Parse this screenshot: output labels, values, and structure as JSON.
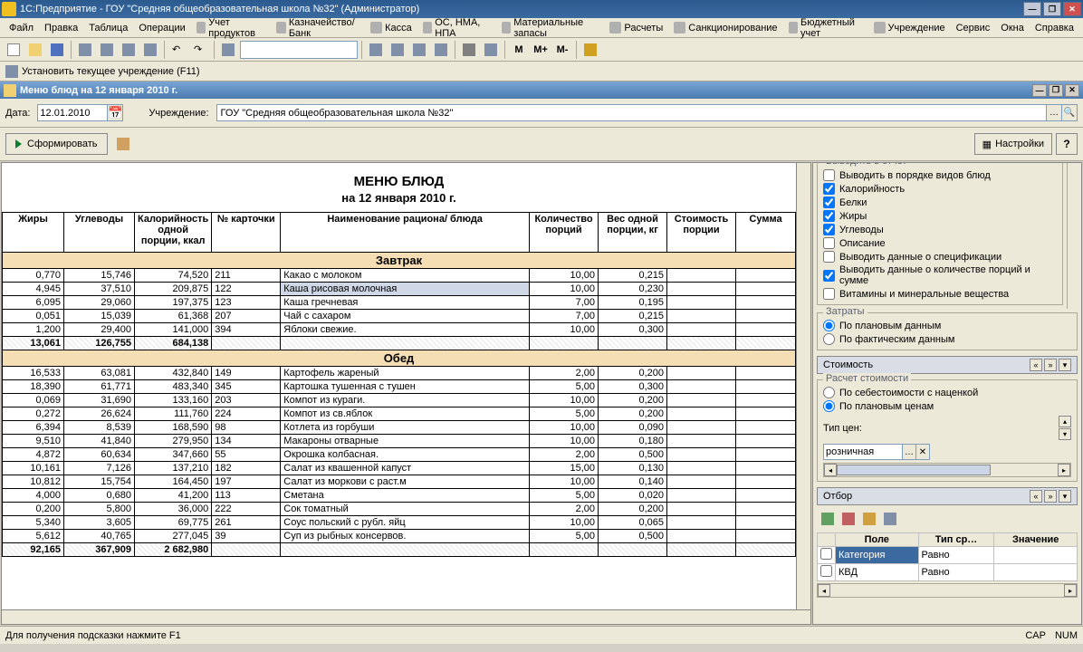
{
  "app_title": "1С:Предприятие - ГОУ \"Средняя общеобразовательная школа №32\" (Администратор)",
  "menu": [
    "Файл",
    "Правка",
    "Таблица",
    "Операции",
    "Учет продуктов",
    "Казначейство/Банк",
    "Касса",
    "ОС, НМА, НПА",
    "Материальные запасы",
    "Расчеты",
    "Санкционирование",
    "Бюджетный учет",
    "Учреждение",
    "Сервис",
    "Окна",
    "Справка"
  ],
  "subbar_text": "Установить текущее учреждение (F11)",
  "tb_mtext": [
    "M",
    "M+",
    "M-"
  ],
  "doc_title": "Меню блюд на 12 января 2010 г.",
  "params": {
    "date_label": "Дата:",
    "date_value": "12.01.2010",
    "org_label": "Учреждение:",
    "org_value": "ГОУ \"Средняя общеобразовательная школа №32\""
  },
  "form_btn": "Сформировать",
  "settings_btn": "Настройки",
  "report": {
    "title": "МЕНЮ БЛЮД",
    "subtitle": "на 12 января 2010 г.",
    "headers": [
      "Жиры",
      "Углеводы",
      "Калорийность одной порции, ккал",
      "№ карточки",
      "Наименование рациона/ блюда",
      "Количество порций",
      "Вес одной порции, кг",
      "Стоимость порции",
      "Сумма"
    ],
    "sections": [
      {
        "name": "Завтрак",
        "rows": [
          {
            "f": "0,770",
            "c": "15,746",
            "k": "74,520",
            "n": "211",
            "d": "Какао с молоком",
            "q": "10,00",
            "w": "0,215"
          },
          {
            "f": "4,945",
            "c": "37,510",
            "k": "209,875",
            "n": "122",
            "d": "Каша рисовая молочная",
            "q": "10,00",
            "w": "0,230",
            "sel": true
          },
          {
            "f": "6,095",
            "c": "29,060",
            "k": "197,375",
            "n": "123",
            "d": "Каша гречневая",
            "q": "7,00",
            "w": "0,195"
          },
          {
            "f": "0,051",
            "c": "15,039",
            "k": "61,368",
            "n": "207",
            "d": "Чай с сахаром",
            "q": "7,00",
            "w": "0,215"
          },
          {
            "f": "1,200",
            "c": "29,400",
            "k": "141,000",
            "n": "394",
            "d": "Яблоки свежие.",
            "q": "10,00",
            "w": "0,300"
          }
        ],
        "total": {
          "f": "13,061",
          "c": "126,755",
          "k": "684,138"
        }
      },
      {
        "name": "Обед",
        "rows": [
          {
            "f": "16,533",
            "c": "63,081",
            "k": "432,840",
            "n": "149",
            "d": "Картофель жареный",
            "q": "2,00",
            "w": "0,200"
          },
          {
            "f": "18,390",
            "c": "61,771",
            "k": "483,340",
            "n": "345",
            "d": "Картошка тушенная с тушен",
            "q": "5,00",
            "w": "0,300"
          },
          {
            "f": "0,069",
            "c": "31,690",
            "k": "133,160",
            "n": "203",
            "d": "Компот из кураги.",
            "q": "10,00",
            "w": "0,200"
          },
          {
            "f": "0,272",
            "c": "26,624",
            "k": "111,760",
            "n": "224",
            "d": "Компот из св.яблок",
            "q": "5,00",
            "w": "0,200"
          },
          {
            "f": "6,394",
            "c": "8,539",
            "k": "168,590",
            "n": "98",
            "d": "Котлета из горбуши",
            "q": "10,00",
            "w": "0,090"
          },
          {
            "f": "9,510",
            "c": "41,840",
            "k": "279,950",
            "n": "134",
            "d": "Макароны отварные",
            "q": "10,00",
            "w": "0,180"
          },
          {
            "f": "4,872",
            "c": "60,634",
            "k": "347,660",
            "n": "55",
            "d": "Окрошка колбасная.",
            "q": "2,00",
            "w": "0,500"
          },
          {
            "f": "10,161",
            "c": "7,126",
            "k": "137,210",
            "n": "182",
            "d": "Салат из квашенной капуст",
            "q": "15,00",
            "w": "0,130"
          },
          {
            "f": "10,812",
            "c": "15,754",
            "k": "164,450",
            "n": "197",
            "d": "Салат из моркови с раст.м",
            "q": "10,00",
            "w": "0,140"
          },
          {
            "f": "4,000",
            "c": "0,680",
            "k": "41,200",
            "n": "113",
            "d": "Сметана",
            "q": "5,00",
            "w": "0,020"
          },
          {
            "f": "0,200",
            "c": "5,800",
            "k": "36,000",
            "n": "222",
            "d": "Сок томатный",
            "q": "2,00",
            "w": "0,200"
          },
          {
            "f": "5,340",
            "c": "3,605",
            "k": "69,775",
            "n": "261",
            "d": "Соус польский с рубл. яйц",
            "q": "10,00",
            "w": "0,065"
          },
          {
            "f": "5,612",
            "c": "40,765",
            "k": "277,045",
            "n": "39",
            "d": "Суп из рыбных консервов.",
            "q": "5,00",
            "w": "0,500"
          }
        ],
        "total": {
          "f": "92,165",
          "c": "367,909",
          "k": "2 682,980"
        }
      }
    ]
  },
  "side": {
    "output_grp": "Выводить в отчет",
    "checks": [
      {
        "label": "Выводить в порядке видов блюд",
        "v": false
      },
      {
        "label": "Калорийность",
        "v": true
      },
      {
        "label": "Белки",
        "v": true
      },
      {
        "label": "Жиры",
        "v": true
      },
      {
        "label": "Углеводы",
        "v": true
      },
      {
        "label": "Описание",
        "v": false
      },
      {
        "label": "Выводить данные о спецификации",
        "v": false
      },
      {
        "label": "Выводить данные о количестве порций и сумме",
        "v": true
      },
      {
        "label": "Витамины и минеральные вещества",
        "v": false
      }
    ],
    "cost_grp": "Затраты",
    "radios_cost": [
      {
        "label": "По плановым данным",
        "v": true
      },
      {
        "label": "По фактическим данным",
        "v": false
      }
    ],
    "price_hdr": "Стоимость",
    "calc_grp": "Расчет стоимости",
    "radios_calc": [
      {
        "label": "По себестоимости с наценкой",
        "v": false
      },
      {
        "label": "По плановым ценам",
        "v": true
      }
    ],
    "price_type_lbl": "Тип цен:",
    "price_type_val": "розничная",
    "filter_hdr": "Отбор",
    "filter_cols": [
      "",
      "Поле",
      "Тип ср…",
      "Значение"
    ],
    "filter_rows": [
      {
        "field": "Категория",
        "op": "Равно",
        "val": "",
        "sel": true
      },
      {
        "field": "КВД",
        "op": "Равно",
        "val": ""
      }
    ]
  },
  "status": {
    "hint": "Для получения подсказки нажмите F1",
    "cap": "CAP",
    "num": "NUM"
  }
}
